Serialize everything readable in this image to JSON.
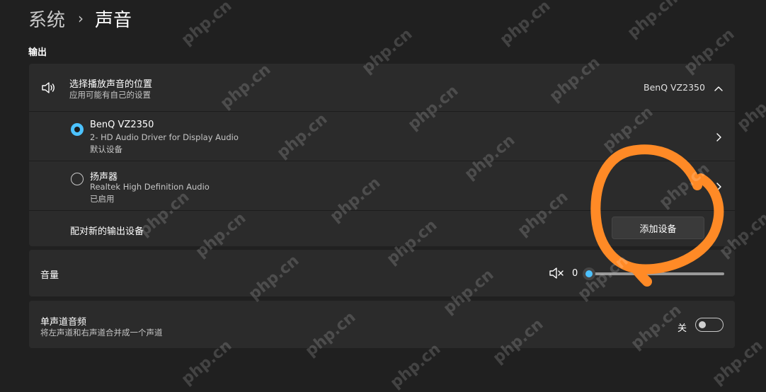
{
  "breadcrumb": {
    "parent": "系统",
    "separator": "›",
    "current": "声音"
  },
  "output": {
    "section_title": "输出",
    "choose_device": {
      "title": "选择播放声音的位置",
      "subtitle": "应用可能有自己的设置",
      "selected_value": "BenQ VZ2350"
    },
    "devices": [
      {
        "name": "BenQ VZ2350",
        "line2": "2- HD Audio Driver for Display Audio",
        "line3": "默认设备",
        "selected": true
      },
      {
        "name": "扬声器",
        "line2": "Realtek High Definition Audio",
        "line3": "已启用",
        "selected": false
      }
    ],
    "pair_new": {
      "label": "配对新的输出设备",
      "button_label": "添加设备"
    },
    "volume": {
      "label": "音量",
      "value": "0",
      "level": 0
    },
    "mono_audio": {
      "title": "单声道音频",
      "subtitle": "将左声道和右声道合并成一个声道",
      "state_label": "关"
    }
  },
  "watermark_text": "php.cn",
  "colors": {
    "accent": "#4cc2ff",
    "annotation": "#ff8a26",
    "background": "#202020",
    "card": "#2b2b2b"
  },
  "icons": [
    "speaker-icon",
    "chevron-up-icon",
    "chevron-right-icon",
    "volume-muted-icon"
  ]
}
